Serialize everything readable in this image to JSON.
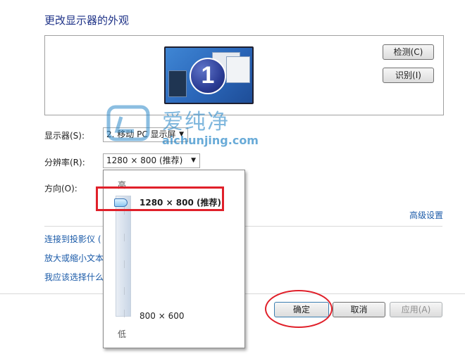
{
  "page": {
    "title": "更改显示器的外观"
  },
  "preview": {
    "monitor_number": "1",
    "detect_label": "检测(C)",
    "identify_label": "识别(I)"
  },
  "settings": {
    "display_label": "显示器(S):",
    "display_value": "2. 移动 PC 显示屏",
    "resolution_label": "分辨率(R):",
    "resolution_value": "1280 × 800 (推荐)",
    "orientation_label": "方向(O):"
  },
  "resolution_popup": {
    "high_label": "高",
    "low_label": "低",
    "max_option": "1280 × 800 (推荐)",
    "min_option": "800 × 600",
    "slider_position_fraction": 1.0
  },
  "links": {
    "advanced": "高级设置",
    "projector": "连接到投影仪 (",
    "text_size": "放大或缩小文本",
    "which_settings": "我应该选择什么"
  },
  "footer": {
    "ok_label": "确定",
    "cancel_label": "取消",
    "apply_label": "应用(A)"
  },
  "watermark": {
    "brand": "爱纯净",
    "url": "aichunjing.com"
  },
  "colors": {
    "title": "#1e3287",
    "link": "#1a5aa8",
    "highlight": "#e0202a"
  }
}
